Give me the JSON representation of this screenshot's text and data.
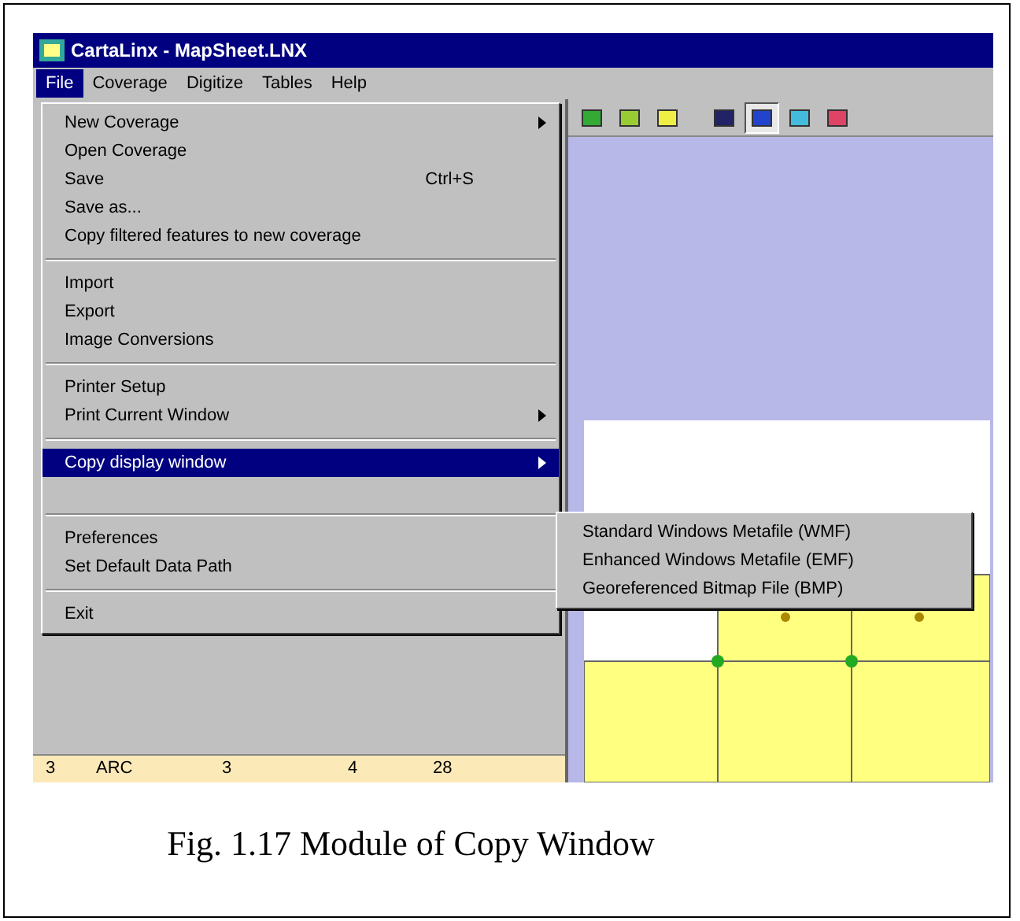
{
  "window": {
    "title": "CartaLinx - MapSheet.LNX"
  },
  "menubar": [
    {
      "label": "File",
      "selected": true
    },
    {
      "label": "Coverage",
      "selected": false
    },
    {
      "label": "Digitize",
      "selected": false
    },
    {
      "label": "Tables",
      "selected": false
    },
    {
      "label": "Help",
      "selected": false
    }
  ],
  "file_menu": [
    {
      "kind": "item",
      "label": "New Coverage",
      "submenu": true,
      "selected": false
    },
    {
      "kind": "item",
      "label": "Open Coverage",
      "submenu": false,
      "selected": false
    },
    {
      "kind": "item",
      "label": "Save",
      "shortcut": "Ctrl+S",
      "submenu": false,
      "selected": false
    },
    {
      "kind": "item",
      "label": "Save as...",
      "submenu": false,
      "selected": false
    },
    {
      "kind": "item",
      "label": "Copy filtered features to new coverage",
      "submenu": false,
      "selected": false
    },
    {
      "kind": "separator"
    },
    {
      "kind": "item",
      "label": "Import",
      "submenu": false,
      "selected": false
    },
    {
      "kind": "item",
      "label": "Export",
      "submenu": false,
      "selected": false
    },
    {
      "kind": "item",
      "label": "Image Conversions",
      "submenu": false,
      "selected": false
    },
    {
      "kind": "separator"
    },
    {
      "kind": "item",
      "label": "Printer Setup",
      "submenu": false,
      "selected": false
    },
    {
      "kind": "item",
      "label": "Print Current Window",
      "submenu": true,
      "selected": false
    },
    {
      "kind": "separator"
    },
    {
      "kind": "item",
      "label": "Copy display window",
      "submenu": true,
      "selected": true
    },
    {
      "kind": "blank"
    },
    {
      "kind": "separator"
    },
    {
      "kind": "item",
      "label": "Preferences",
      "submenu": false,
      "selected": false
    },
    {
      "kind": "item",
      "label": "Set Default Data Path",
      "submenu": false,
      "selected": false
    },
    {
      "kind": "separator"
    },
    {
      "kind": "item",
      "label": "Exit",
      "submenu": false,
      "selected": false
    }
  ],
  "submenu": [
    "Standard Windows Metafile (WMF)",
    "Enhanced Windows Metafile (EMF)",
    "Georeferenced Bitmap File (BMP)"
  ],
  "table_row": [
    "3",
    "ARC",
    "3",
    "4",
    "28"
  ],
  "caption": "Fig. 1.17 Module of Copy Window"
}
